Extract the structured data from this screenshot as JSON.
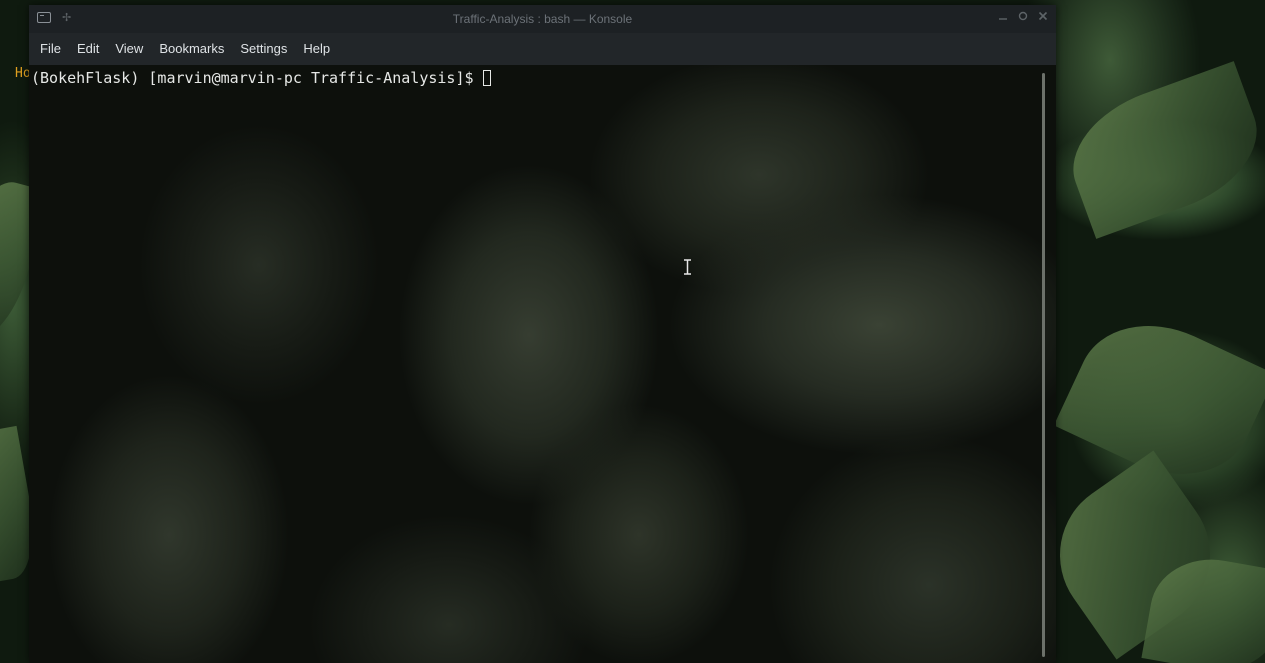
{
  "window": {
    "title": "Traffic-Analysis : bash — Konsole",
    "app_icon": "terminal-icon",
    "pin_icon": "pin-icon",
    "controls": {
      "minimize": "minimize-icon",
      "maximize": "maximize-icon",
      "close": "close-icon"
    }
  },
  "menubar": {
    "items": [
      {
        "label": "File"
      },
      {
        "label": "Edit"
      },
      {
        "label": "View"
      },
      {
        "label": "Bookmarks"
      },
      {
        "label": "Settings"
      },
      {
        "label": "Help"
      }
    ]
  },
  "terminal": {
    "prompt": "(BokehFlask) [marvin@marvin-pc Traffic-Analysis]$",
    "input": ""
  },
  "desktop": {
    "partial_text": "Ho"
  },
  "colors": {
    "titlebar_bg": "#1d2124",
    "menubar_bg": "#222629",
    "menu_text": "#dfe3e6",
    "terminal_text": "#e6e8e6",
    "desktop_accent": "#e0a020"
  }
}
